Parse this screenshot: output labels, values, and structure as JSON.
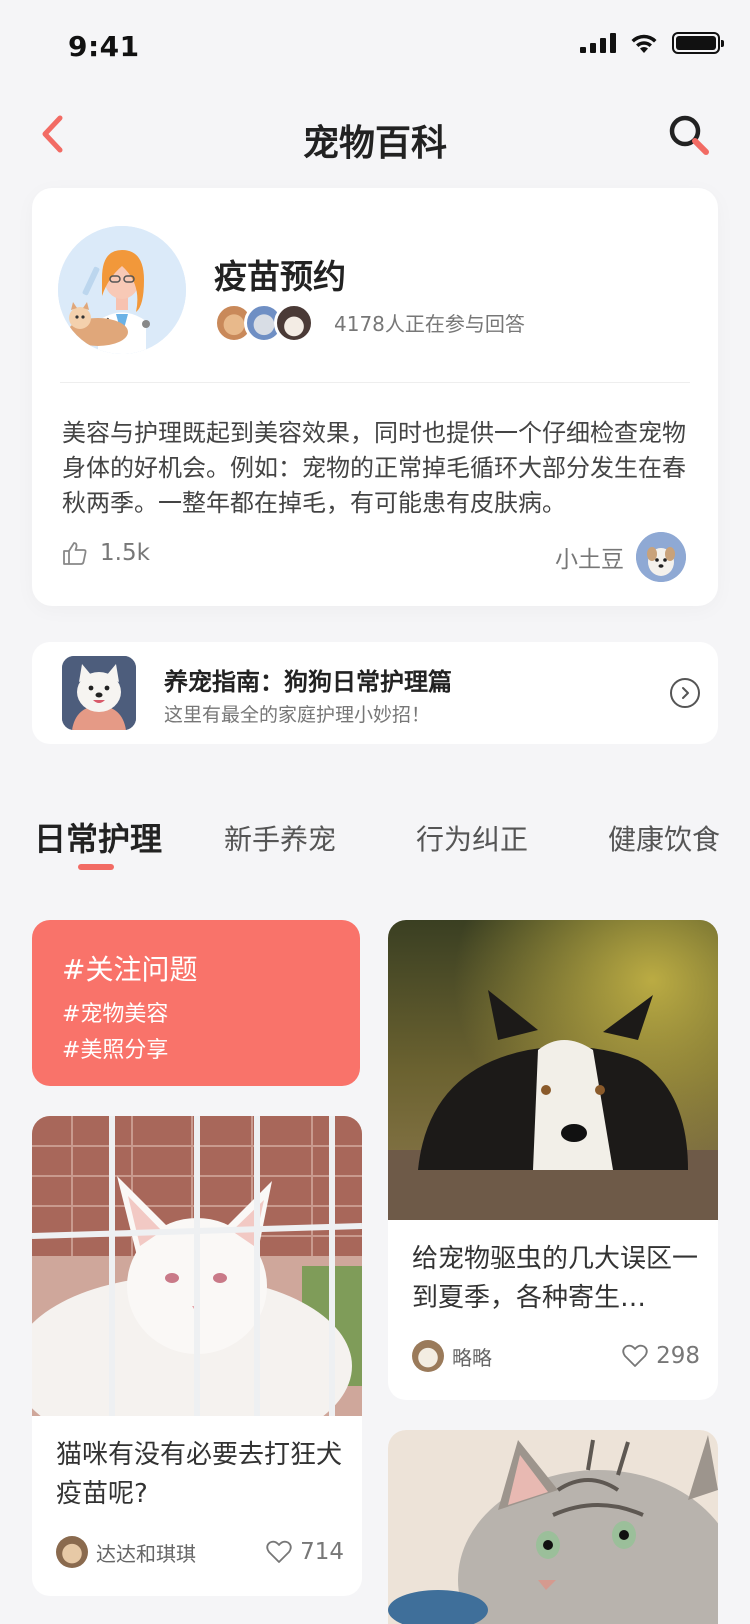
{
  "status": {
    "time": "9:41"
  },
  "nav": {
    "title": "宠物百科"
  },
  "featured": {
    "title": "疫苗预约",
    "participants": "4178人正在参与回答",
    "body": "美容与护理既起到美容效果，同时也提供一个仔细检查宠物身体的好机会。例如：宠物的正常掉毛循环大部分发生在春秋两季。一整年都在掉毛，有可能患有皮肤病。",
    "likes": "1.5k",
    "author": "小土豆"
  },
  "guide": {
    "title": "养宠指南：狗狗日常护理篇",
    "subtitle": "这里有最全的家庭护理小妙招！"
  },
  "tabs": [
    "日常护理",
    "新手养宠",
    "行为纠正",
    "健康饮食"
  ],
  "topics": {
    "main": "#关注问题",
    "items": [
      "#宠物美容",
      "#美照分享"
    ]
  },
  "posts": [
    {
      "title": "给宠物驱虫的几大误区一到夏季，各种寄生…",
      "author": "略略",
      "likes": "298"
    },
    {
      "title": "猫咪有没有必要去打狂犬疫苗呢?",
      "author": "达达和琪琪",
      "likes": "714"
    }
  ],
  "colors": {
    "accent": "#f26b64",
    "topic_bg": "#f9736a",
    "background": "#f5f5f7"
  }
}
